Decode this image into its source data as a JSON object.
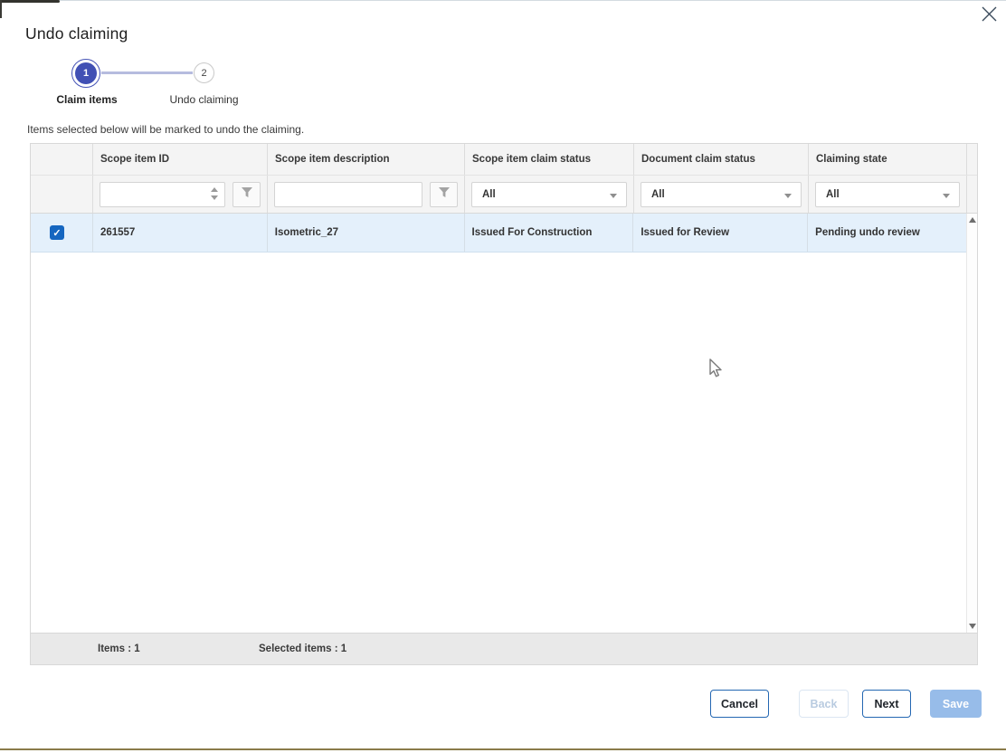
{
  "dialog": {
    "title": "Undo claiming",
    "subtitle": "Items selected below will be marked to undo the claiming."
  },
  "stepper": {
    "steps": [
      {
        "number": "1",
        "label": "Claim items",
        "state": "active"
      },
      {
        "number": "2",
        "label": "Undo claiming",
        "state": "upcoming"
      }
    ]
  },
  "table": {
    "columns": [
      "",
      "Scope item ID",
      "Scope item description",
      "Scope item claim status",
      "Document claim status",
      "Claiming state"
    ],
    "filters": {
      "scope_item_id": {
        "value": "",
        "type": "number"
      },
      "scope_item_description": {
        "value": "",
        "type": "text"
      },
      "scope_item_claim_status": {
        "value": "All"
      },
      "document_claim_status": {
        "value": "All"
      },
      "claiming_state": {
        "value": "All"
      }
    },
    "rows": [
      {
        "checked": true,
        "scope_item_id": "261557",
        "description": "Isometric_27",
        "claim_status": "Issued For Construction",
        "doc_claim_status": "Issued for Review",
        "claiming_state": "Pending undo review"
      }
    ],
    "footer": {
      "items_text": "Items : 1",
      "selected_text": "Selected items : 1"
    }
  },
  "buttons": {
    "cancel": "Cancel",
    "back": "Back",
    "next": "Next",
    "save": "Save"
  },
  "icons": {
    "close": "✕",
    "check": "✓",
    "filter": "funnel",
    "caret_down": "▾",
    "spinner": "▴▾",
    "scroll": "▲▼",
    "cursor": "arrow-pointer"
  },
  "colors": {
    "accent_blue": "#2467b2",
    "step_indigo": "#4150b4",
    "selected_row_bg": "#e4f0fb",
    "checkbox_blue": "#1566c0",
    "save_disabled_bg": "#97bce9",
    "header_bg": "#f4f4f4",
    "footer_bg": "#e9e9e9"
  }
}
